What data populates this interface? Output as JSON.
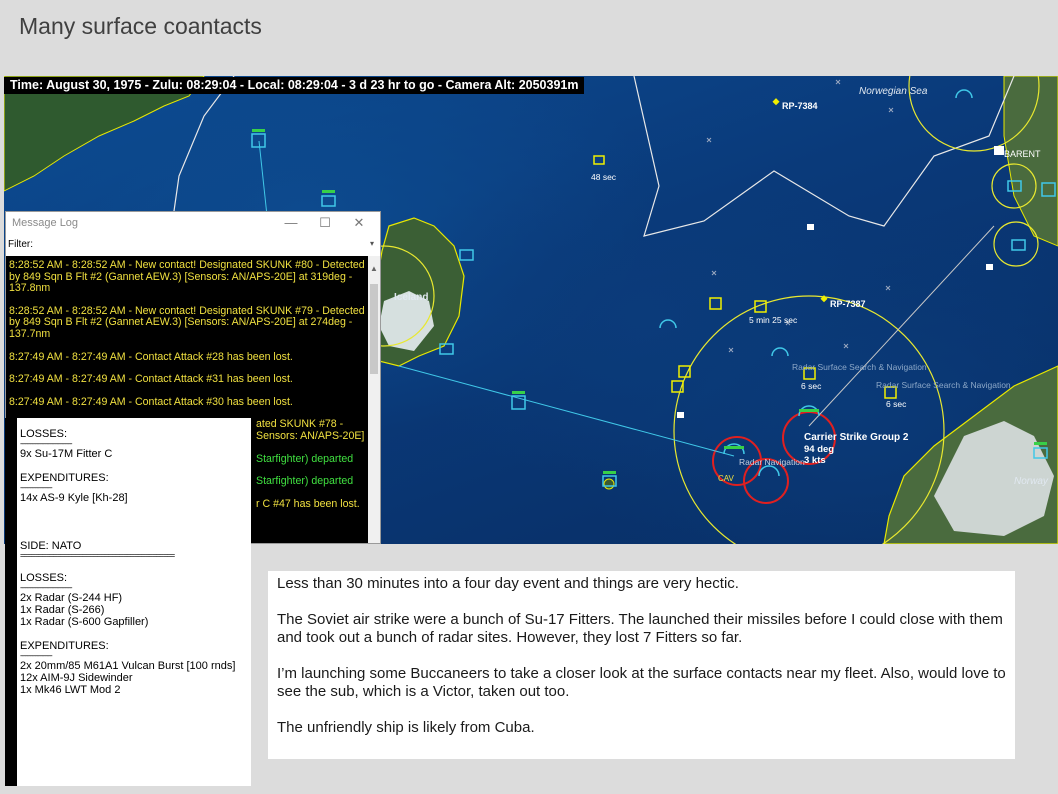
{
  "slide": {
    "title": "Many surface coantacts"
  },
  "status_bar": {
    "text": "Time: August 30, 1975 - Zulu: 08:29:04 - Local: 08:29:04 - 3 d 23 hr to go -  Camera Alt: 2050391m"
  },
  "map": {
    "labels": {
      "norwegian_sea": "Norwegian Sea",
      "iceland": "Iceland",
      "norway": "Norway",
      "barents": "BARENT",
      "rp7384": "RP-7384",
      "rp7387": "RP-7387",
      "sec48": "48 sec",
      "min5sec25": "5 min 25 sec",
      "sec6a": "6 sec",
      "sec6b": "6 sec",
      "radar1": "Radar Surface Search & Navigation",
      "radar2": "Radar Surface Search & Navigation",
      "radar3": "Radar Navigation",
      "csg2": "Carrier Strike Group 2",
      "deg": "94 deg",
      "kts": "3 kts",
      "cav": "CAV"
    },
    "colors": {
      "range_ring": "#e8e830",
      "friendly": "#40c8e8",
      "contact": "#f0f000",
      "white_line": "#e8e8e8"
    }
  },
  "message_log": {
    "title": "Message Log",
    "filter_label": "Filter:",
    "messages": [
      {
        "text": "8:28:52 AM - 8:28:52 AM - New contact! Designated SKUNK #80 - Detected by 849 Sqn B Flt #2 (Gannet AEW.3) [Sensors: AN/APS-20E] at 319deg - 137.8nm",
        "color": "#f0e040"
      },
      {
        "text": "8:28:52 AM - 8:28:52 AM - New contact! Designated SKUNK #79 - Detected by 849 Sqn B Flt #2 (Gannet AEW.3) [Sensors: AN/APS-20E] at 274deg - 137.7nm",
        "color": "#f0e040"
      },
      {
        "text": "8:27:49 AM - 8:27:49 AM - Contact Attack #28 has been lost.",
        "color": "#f0e040"
      },
      {
        "text": "8:27:49 AM - 8:27:49 AM - Contact Attack #31 has been lost.",
        "color": "#f0e040"
      },
      {
        "text": "8:27:49 AM - 8:27:49 AM - Contact Attack #30 has been lost.",
        "color": "#f0e040"
      },
      {
        "text": "ated SKUNK #78 - Sensors: AN/APS-20E]",
        "color": "#f0e040"
      },
      {
        "text": "Starfighter) departed",
        "color": "#40e040"
      },
      {
        "text": "Starfighter) departed",
        "color": "#40e040"
      },
      {
        "text": "r C #47 has been lost.",
        "color": "#f0e040"
      }
    ]
  },
  "losses_panel": {
    "lines": [
      "LOSSES:",
      "-------------------------------",
      "9x Su-17M Fitter C",
      "",
      "EXPENDITURES:",
      "-------------------",
      "14x AS-9 Kyle [Kh-28]",
      "",
      "",
      "SIDE: NATO",
      "==========================================",
      "",
      "LOSSES:",
      "-------------------------------",
      "2x Radar (S-244 HF)",
      "1x Radar (S-266)",
      "1x Radar (S-600 Gapfiller)",
      "",
      "EXPENDITURES:",
      "-------------------",
      "2x 20mm/85 M61A1 Vulcan Burst [100 rnds]",
      "12x AIM-9J Sidewinder",
      "1x Mk46 LWT Mod 2"
    ]
  },
  "commentary": {
    "paragraphs": [
      "Less than 30 minutes into a four day event and things are very hectic.",
      "The Soviet air strike were a bunch of Su-17 Fitters.  The launched their missiles before I could close with them and took out a bunch of radar sites.  However, they lost 7 Fitters so far.",
      "I’m launching some Buccaneers to take a closer look at the surface contacts near my fleet.  Also, would love to see the sub, which is a Victor, taken out too.",
      "The unfriendly ship is likely from Cuba."
    ]
  }
}
